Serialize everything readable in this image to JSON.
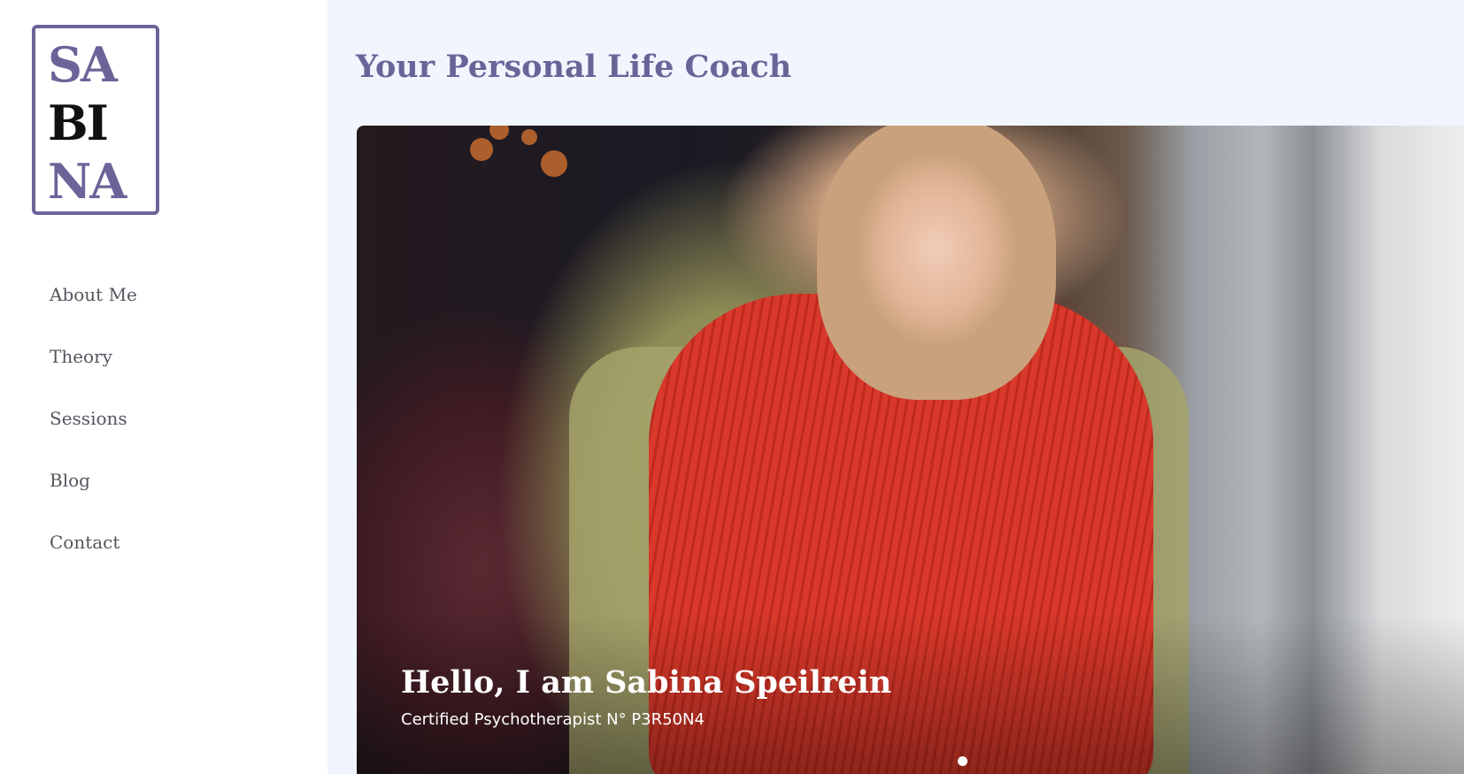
{
  "logo": {
    "lines": [
      "SA",
      "BI",
      "NA"
    ]
  },
  "nav": {
    "items": [
      {
        "label": "About Me"
      },
      {
        "label": "Theory"
      },
      {
        "label": "Sessions"
      },
      {
        "label": "Blog"
      },
      {
        "label": "Contact"
      }
    ]
  },
  "header": {
    "title": "Your Personal Life Coach"
  },
  "hero": {
    "heading": "Hello, I am Sabina Speilrein",
    "subtitle": "Certified Psychotherapist N° P3R50N4",
    "slide_count": 1,
    "active_slide": 1
  },
  "colors": {
    "accent": "#6a6499",
    "sidebar_background": "#ffffff",
    "page_background": "#f1f5fd",
    "nav_text": "#55555f"
  }
}
